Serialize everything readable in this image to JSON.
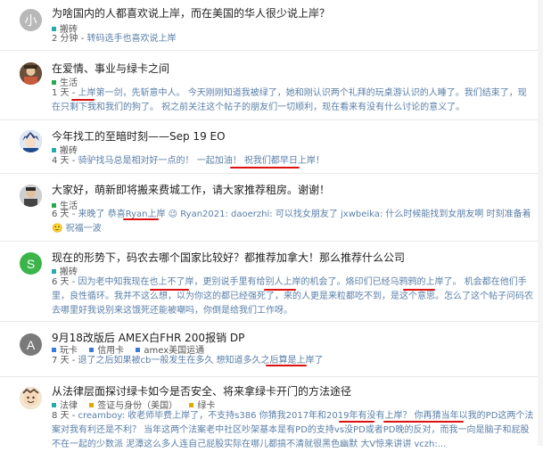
{
  "colors": {
    "link_blue": "#5a7fa8",
    "underline_red": "#dd1111",
    "cat_teal": "#25aaad",
    "cat_amber": "#e0a800",
    "cat_blue": "#3a7bd5",
    "cat_green": "#27a84f"
  },
  "topics": [
    {
      "avatar_letter": "小",
      "avatar_color": "#b8b8b8",
      "avatar_icon": "letter-avatar",
      "title": "为啥国内的人都喜欢说上岸，而在美国的华人很少说上岸？",
      "categories": [
        {
          "label": "搬砖",
          "color": "#25aaad"
        }
      ],
      "age": "2 分钟",
      "excerpt": "转码选手也喜欢说上岸"
    },
    {
      "avatar_letter": "",
      "avatar_color": "#6b4f3a",
      "avatar_icon": "photo-avatar",
      "title": "在爱情、事业与绿卡之间",
      "categories": [
        {
          "label": "生活",
          "color": "#27a84f"
        }
      ],
      "age": "1 天",
      "excerpt": "上岸第一剑，先斩意中人。 今天刚刚知道我被绿了，她和刚认识两个礼拜的玩桌游认识的人睡了。我们结束了，现在只剩下我和我们的狗了。 祝之前关注这个帖子的朋友们一切顺利，现在看来有没有什么讨论的意义了。"
    },
    {
      "avatar_letter": "",
      "avatar_color": "#2b6cb0",
      "avatar_icon": "anime-avatar",
      "title": "今年找工的至暗时刻——Sep 19 EO",
      "categories": [
        {
          "label": "搬砖",
          "color": "#25aaad"
        }
      ],
      "age": "4 天",
      "excerpt": "骑驴找马总是相对好一点的！ 一起加油！ 祝我们都早日上岸！"
    },
    {
      "avatar_letter": "",
      "avatar_color": "#8a8a8a",
      "avatar_icon": "photo-avatar",
      "title": "大家好，萌新即将搬来费城工作，请大家推荐租房。谢谢！",
      "categories": [
        {
          "label": "生活",
          "color": "#27a84f"
        }
      ],
      "age": "6 天",
      "excerpt": "来晚了 恭喜Ryan上岸 😉 Ryan2021: daoerzhi: 可以找女朋友了 jxwbeika: 什么时候能找到女朋友啊 时刻准备着 🙂 祝福一波"
    },
    {
      "avatar_letter": "S",
      "avatar_color": "#3bb54a",
      "avatar_icon": "letter-avatar",
      "title": "现在的形势下，码农去哪个国家比较好？都推荐加拿大！那么推荐什么公司",
      "categories": [
        {
          "label": "搬砖",
          "color": "#25aaad"
        }
      ],
      "age": "6 天",
      "excerpt": "因为老中知我现在也上不了岸，更别说手里有给别人上岸的机会了。烙印们已经乌鸦鸦的上岸了。 机会都在他们手里，良性循环。我并不这么想，以为你这的都已经强死了，来的人更是来粒都吃不到，是这个意思。怎么了这个帖子问码农去哪里好我说别来这饿死还能被嘲吗，你倒是给我们工作呀。"
    },
    {
      "avatar_letter": "A",
      "avatar_color": "#7a7a7a",
      "avatar_icon": "letter-avatar",
      "title": "9月18改版后 AMEX白FHR 200报销 DP",
      "categories": [
        {
          "label": "玩卡",
          "color": "#3a7bd5"
        },
        {
          "label": "信用卡",
          "color": "#3a7bd5"
        },
        {
          "label": "amex美国运通",
          "color": "#3a7bd5"
        }
      ],
      "age": "7 天",
      "excerpt": "退了之后如果被cb一般发生在多久 想知道多久之后算是上岸了"
    },
    {
      "avatar_letter": "",
      "avatar_color": "#c9a07a",
      "avatar_icon": "cartoon-avatar",
      "title": "从法律层面探讨绿卡如今是否安全、将来拿绿卡开门的方法途径",
      "categories": [
        {
          "label": "法律",
          "color": "#25aaad"
        },
        {
          "label": "签证与身份（美国）",
          "color": "#e0a800"
        },
        {
          "label": "绿卡",
          "color": "#e0a800"
        }
      ],
      "age": "8 天",
      "excerpt": "creamboy: 收老师毕费上岸了，不支持s386 你猜我2017年和2019年有没有上岸？ 你再猜当年以我的PD这两个法案对我有利还是不利？ 当年这两个法案老中社区吵架基本是有PD的支持vs没PD或者PD晚的反对，而我一向是脑子和屁股不在一起的少数派 泥潭这么多人连自己屁股实际在哪儿都搞不清就很黑色幽默 大V惊来讲讲 vczh:..."
    }
  ]
}
